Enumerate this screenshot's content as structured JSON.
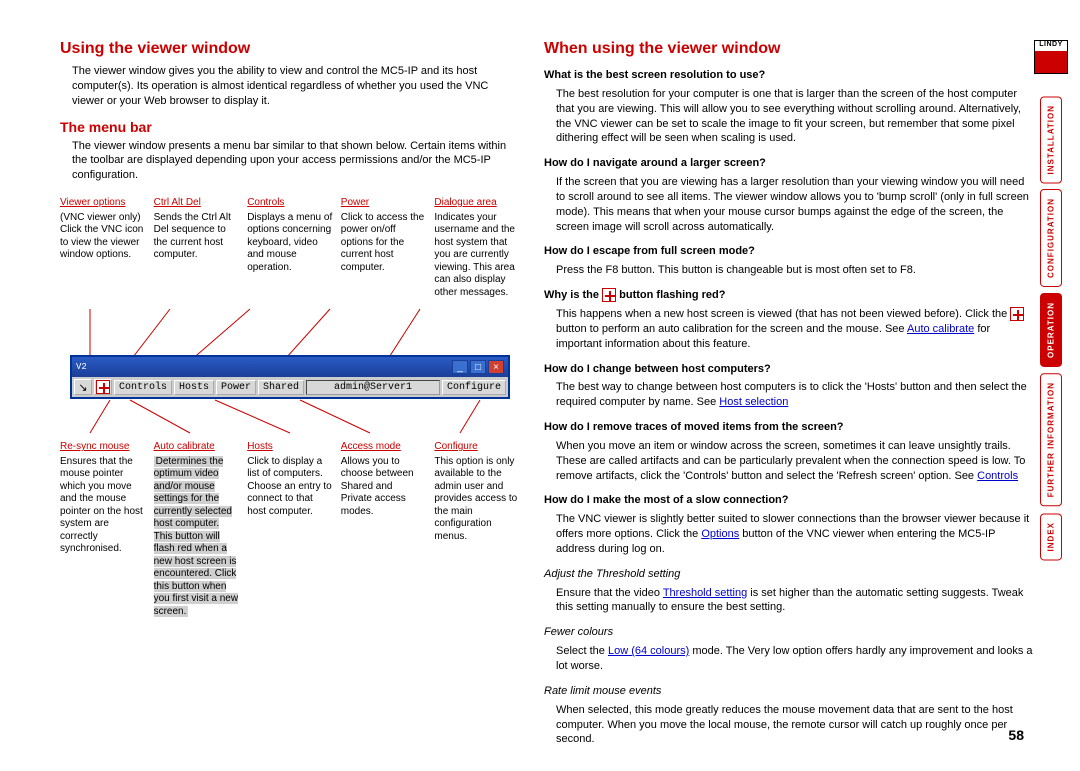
{
  "left": {
    "h_using": "Using the viewer window",
    "p_using": "The viewer window gives you the ability to view and control the MC5-IP and its host computer(s). Its operation is almost identical regardless of whether you used the VNC viewer or your Web browser to display it.",
    "h_menu": "The menu bar",
    "p_menu": "The viewer window presents a menu bar similar to that shown below. Certain items within the toolbar are displayed depending upon your access permissions and/or the MC5-IP configuration.",
    "top_co": [
      {
        "h": "Viewer options",
        "t": "(VNC viewer only) Click the VNC icon to view the viewer window options."
      },
      {
        "h": "Ctrl Alt Del",
        "t": "Sends the Ctrl Alt Del sequence to the current host computer."
      },
      {
        "h": "Controls",
        "t": "Displays a menu of options concerning keyboard, video and mouse operation."
      },
      {
        "h": "Power",
        "t": "Click to access the power on/off options for the current host computer."
      },
      {
        "h": "Dialogue area",
        "t": "Indicates your username and the host system that you are currently viewing. This area can also display other messages."
      }
    ],
    "bot_co": [
      {
        "h": "Re-sync mouse",
        "t": "Ensures that the mouse pointer which you move and the mouse pointer on the host system are correctly synchronised."
      },
      {
        "h": "Auto calibrate",
        "t": "Determines the optimum video and/or mouse settings for the currently selected host computer. This button will flash red when a new host screen is encountered. Click this button when you first visit a new screen.",
        "hl": true
      },
      {
        "h": "Hosts",
        "t": "Click to display a list of computers. Choose an entry to connect to that host computer."
      },
      {
        "h": "Access mode",
        "t": "Allows you to choose between Shared and Private access modes."
      },
      {
        "h": "Configure",
        "t": "This option is only available to the admin user and provides access to the main configuration menus."
      }
    ],
    "tb": {
      "btns": [
        "Controls",
        "Hosts",
        "Power",
        "Shared",
        "admin@Server1",
        "Configure"
      ]
    }
  },
  "right": {
    "h": "When using the viewer window",
    "qa": [
      {
        "q": "What is the best screen resolution to use?",
        "a": "The best resolution for your computer is one that is larger than the screen of the host computer that you are viewing. This will allow you to see everything without scrolling around. Alternatively, the VNC viewer can be set to scale the image to fit your screen, but remember that some pixel dithering effect will be seen when scaling is used."
      },
      {
        "q": "How do I navigate around a larger screen?",
        "a": "If the screen that you are viewing has a larger resolution than your viewing window you will need to scroll around to see all items. The viewer window allows you to 'bump scroll' (only in full screen mode). This means that when your mouse cursor bumps against the edge of the screen, the screen image will scroll across automatically."
      },
      {
        "q": "How do I escape from full screen mode?",
        "a": "Press the F8 button. This button is changeable but is most often set to F8."
      }
    ],
    "why_q": "Why is the",
    "why_q2": "button flashing red?",
    "why_a1": "This happens when a new host screen is viewed (that has not been viewed before). Click the",
    "why_a2": "button to perform an auto calibration for the screen and the mouse. See",
    "why_link": "Auto calibrate",
    "why_a3": "for important information about this feature.",
    "qa2": [
      {
        "q": "How do I change between host computers?",
        "a": "The best way to change between host computers is to click the 'Hosts' button and then select the required computer by name. See ",
        "link": "Host selection"
      },
      {
        "q": "How do I remove traces of moved items from the screen?",
        "a": "When you move an item or window across the screen, sometimes it can leave unsightly trails. These are called artifacts and can be particularly prevalent when the connection speed is low. To remove artifacts, click the 'Controls' button and select the 'Refresh screen' option. See ",
        "link": "Controls"
      },
      {
        "q": "How do I make the most of a slow connection?",
        "a": "The VNC viewer is slightly better suited to slower connections than the browser viewer because it offers more options. Click the ",
        "link": "Options",
        "a2": " button of the VNC viewer when entering the MC5-IP address during log on."
      }
    ],
    "subs": [
      {
        "h": "Adjust the Threshold setting",
        "a": "Ensure that the video ",
        "link": "Threshold setting",
        "a2": " is set higher than the automatic setting suggests. Tweak this setting manually to ensure the best setting."
      },
      {
        "h": "Fewer colours",
        "a": "Select the ",
        "link": "Low (64 colours)",
        "a2": " mode. The Very low option offers hardly any improvement and looks a lot worse."
      },
      {
        "h": "Rate limit mouse events",
        "a": "When selected, this mode greatly reduces the mouse movement data that are sent to the host computer. When you move the local mouse, the remote cursor will catch up roughly once per second."
      }
    ]
  },
  "nav": [
    "INSTALLATION",
    "CONFIGURATION",
    "OPERATION",
    "FURTHER INFORMATION",
    "INDEX"
  ],
  "nav_active": 2,
  "logo": "LINDY",
  "page": "58"
}
